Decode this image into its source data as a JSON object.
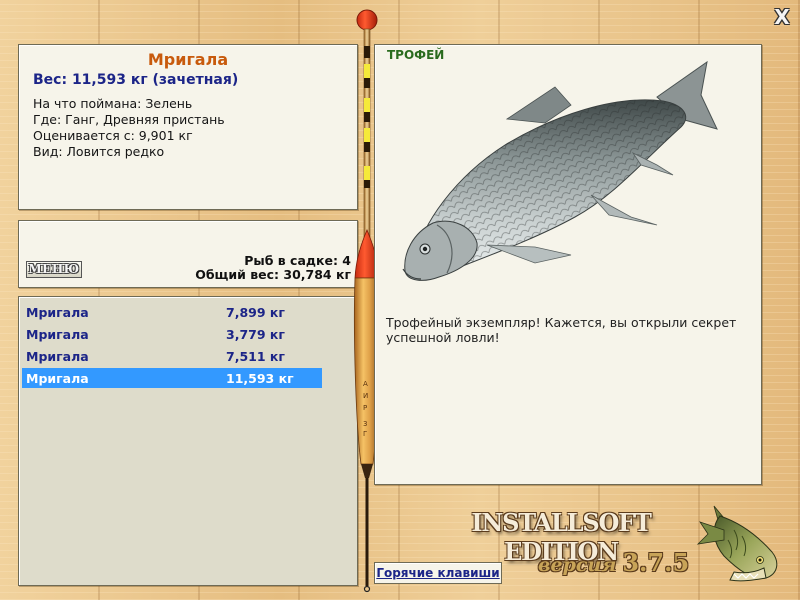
{
  "window": {
    "close_glyph": "X"
  },
  "fish_info": {
    "title": "Мригала",
    "weight_line": "Вес: 11,593 кг (зачетная)",
    "details": [
      "На что поймана: Зелень",
      "Где: Ганг, Древняя пристань",
      "Оценивается с: 9,901 кг",
      "Вид: Ловится редко"
    ]
  },
  "cage": {
    "menu_label": "МЕНЮ",
    "count_line": "Рыб в садке: 4",
    "total_line": "Общий вес: 30,784 кг"
  },
  "catches": [
    {
      "name": "Мригала",
      "weight": "7,899 кг",
      "selected": false
    },
    {
      "name": "Мригала",
      "weight": "3,779 кг",
      "selected": false
    },
    {
      "name": "Мригала",
      "weight": "7,511 кг",
      "selected": false
    },
    {
      "name": "Мригала",
      "weight": "11,593 кг",
      "selected": true
    }
  ],
  "trophy": {
    "label": "ТРОФЕЙ",
    "message": "Трофейный экземпляр! Кажется, вы открыли секрет успешной ловли!"
  },
  "footer": {
    "hotkeys_label": "Горячие клавиши",
    "brand": "INSTALLSOFT EDITION",
    "version_label": "версия",
    "version_number": "3.7.5"
  },
  "icons": {
    "close": "close-icon",
    "float": "fishing-float-icon",
    "fish": "fish-image",
    "logo": "pike-logo-icon"
  },
  "colors": {
    "selection": "#3399ff",
    "title_orange": "#c85a0c",
    "link_blue": "#1c2588",
    "trophy_green": "#2a6b1e",
    "wood": "#e9c48a"
  }
}
